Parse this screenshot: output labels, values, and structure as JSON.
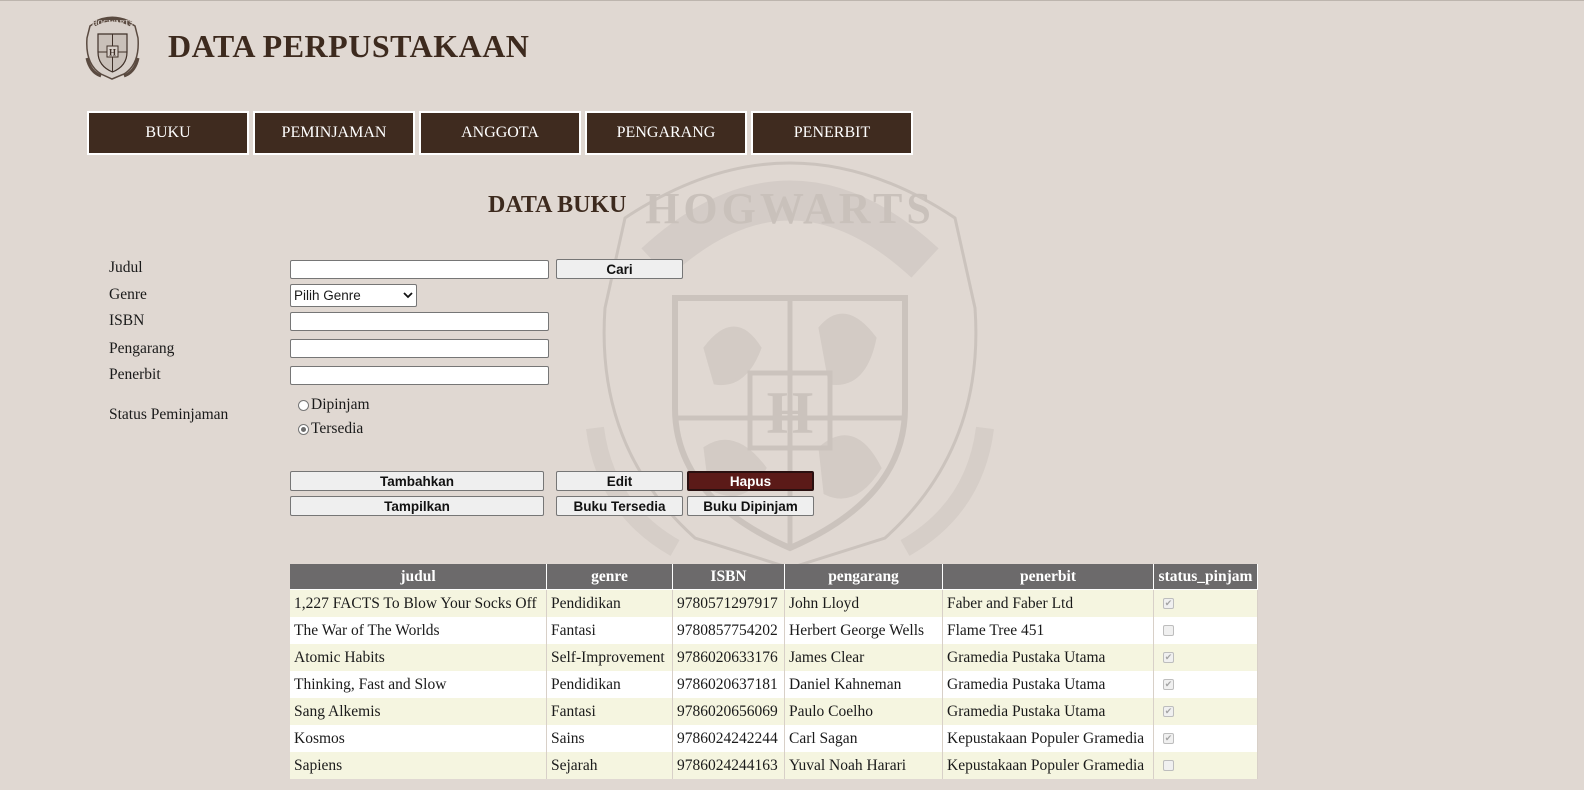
{
  "header": {
    "title": "DATA PERPUSTAKAAN",
    "logo_icon": "hogwarts-crest-icon"
  },
  "nav": [
    {
      "label": "BUKU"
    },
    {
      "label": "PEMINJAMAN"
    },
    {
      "label": "ANGGOTA"
    },
    {
      "label": "PENGARANG"
    },
    {
      "label": "PENERBIT"
    }
  ],
  "section_title": "DATA BUKU",
  "form": {
    "judul_label": "Judul",
    "genre_label": "Genre",
    "isbn_label": "ISBN",
    "pengarang_label": "Pengarang",
    "penerbit_label": "Penerbit",
    "status_label": "Status Peminjaman",
    "genre_selected": "Pilih Genre",
    "judul_value": "",
    "isbn_value": "",
    "pengarang_value": "",
    "penerbit_value": "",
    "radio_dipinjam": "Dipinjam",
    "radio_tersedia": "Tersedia",
    "selected_status": "Tersedia"
  },
  "buttons": {
    "cari": "Cari",
    "tambahkan": "Tambahkan",
    "edit": "Edit",
    "hapus": "Hapus",
    "tampilkan": "Tampilkan",
    "buku_tersedia": "Buku Tersedia",
    "buku_dipinjam": "Buku Dipinjam"
  },
  "table": {
    "headers": {
      "judul": "judul",
      "genre": "genre",
      "isbn": "ISBN",
      "pengarang": "pengarang",
      "penerbit": "penerbit",
      "status": "status_pinjam"
    },
    "rows": [
      {
        "judul": "1,227 FACTS To Blow Your Socks Off",
        "genre": "Pendidikan",
        "isbn": "9780571297917",
        "pengarang": "John Lloyd",
        "penerbit": "Faber and Faber Ltd",
        "status_pinjam": true
      },
      {
        "judul": "The War of The Worlds",
        "genre": "Fantasi",
        "isbn": "9780857754202",
        "pengarang": "Herbert George Wells",
        "penerbit": "Flame Tree 451",
        "status_pinjam": false
      },
      {
        "judul": "Atomic Habits",
        "genre": "Self-Improvement",
        "isbn": "9786020633176",
        "pengarang": "James Clear",
        "penerbit": "Gramedia Pustaka Utama",
        "status_pinjam": true
      },
      {
        "judul": "Thinking, Fast and Slow",
        "genre": "Pendidikan",
        "isbn": "9786020637181",
        "pengarang": "Daniel Kahneman",
        "penerbit": "Gramedia Pustaka Utama",
        "status_pinjam": true
      },
      {
        "judul": "Sang Alkemis",
        "genre": "Fantasi",
        "isbn": "9786020656069",
        "pengarang": "Paulo Coelho",
        "penerbit": "Gramedia Pustaka Utama",
        "status_pinjam": true
      },
      {
        "judul": "Kosmos",
        "genre": "Sains",
        "isbn": "9786024242244",
        "pengarang": "Carl Sagan",
        "penerbit": "Kepustakaan Populer Gramedia",
        "status_pinjam": true
      },
      {
        "judul": "Sapiens",
        "genre": "Sejarah",
        "isbn": "9786024244163",
        "pengarang": "Yuval Noah Harari",
        "penerbit": "Kepustakaan Populer Gramedia",
        "status_pinjam": false
      }
    ]
  },
  "colors": {
    "nav_bg": "#3f2b1f",
    "danger": "#5b1a18",
    "page_bg": "#e0d8d2",
    "table_header": "#6c6a6b",
    "row_odd": "#f5f5e0"
  }
}
